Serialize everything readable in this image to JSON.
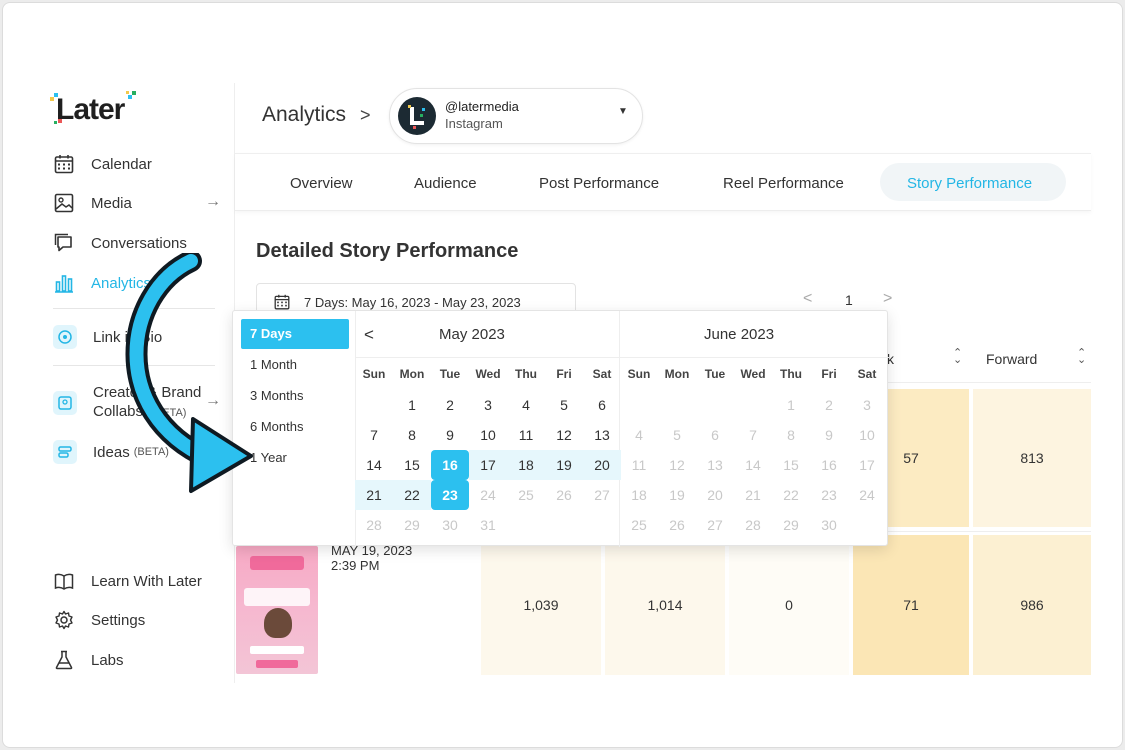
{
  "brand": {
    "name": "Later"
  },
  "sidebar": {
    "items": [
      {
        "label": "Calendar",
        "icon": "calendar-icon"
      },
      {
        "label": "Media",
        "icon": "image-icon"
      },
      {
        "label": "Conversations",
        "icon": "chat-icon"
      },
      {
        "label": "Analytics",
        "icon": "bar-chart-icon",
        "active": true
      },
      {
        "label": "Link in Bio",
        "icon": "link-in-bio-icon"
      },
      {
        "label": "Creator & Brand",
        "label2": "Collabs",
        "beta": "(BETA)",
        "icon": "collabs-icon"
      },
      {
        "label": "Ideas",
        "beta": "(BETA)",
        "icon": "ideas-icon"
      }
    ],
    "bottom": [
      {
        "label": "Learn With Later",
        "icon": "book-icon"
      },
      {
        "label": "Settings",
        "icon": "gear-icon"
      },
      {
        "label": "Labs",
        "icon": "flask-icon"
      }
    ],
    "arrow_glyph": "→"
  },
  "header": {
    "breadcrumb": "Analytics",
    "chevron": ">",
    "account": {
      "handle": "@latermedia",
      "platform": "Instagram",
      "caret": "▼"
    }
  },
  "tabs": [
    {
      "label": "Overview"
    },
    {
      "label": "Audience"
    },
    {
      "label": "Post Performance"
    },
    {
      "label": "Reel Performance"
    },
    {
      "label": "Story Performance",
      "active": true
    }
  ],
  "main": {
    "section_title": "Detailed Story Performance",
    "date_range": "7 Days: May 16, 2023 - May 23, 2023",
    "page": "1",
    "prev": "<",
    "next": ">"
  },
  "table": {
    "headers": {
      "partial": "k",
      "forward": "Forward"
    },
    "row1": {
      "k": "57",
      "forward": "813"
    },
    "row2": {
      "date": "MAY 19, 2023",
      "time": "2:39 PM",
      "c1": "1,039",
      "c2": "1,014",
      "c3": "0",
      "k": "71",
      "forward": "986"
    }
  },
  "popup": {
    "presets": [
      "7 Days",
      "1 Month",
      "3 Months",
      "6 Months",
      "1 Year"
    ],
    "active_preset": "7 Days",
    "prev": "<",
    "may": {
      "title": "May  2023",
      "dow": [
        "Sun",
        "Mon",
        "Tue",
        "Wed",
        "Thu",
        "Fri",
        "Sat"
      ],
      "weeks": [
        [
          "",
          "1",
          "2",
          "3",
          "4",
          "5",
          "6"
        ],
        [
          "7",
          "8",
          "9",
          "10",
          "11",
          "12",
          "13"
        ],
        [
          "14",
          "15",
          "16",
          "17",
          "18",
          "19",
          "20"
        ],
        [
          "21",
          "22",
          "23",
          "24",
          "25",
          "26",
          "27"
        ],
        [
          "28",
          "29",
          "30",
          "31",
          "",
          "",
          ""
        ]
      ]
    },
    "june": {
      "title": "June  2023",
      "dow": [
        "Sun",
        "Mon",
        "Tue",
        "Wed",
        "Thu",
        "Fri",
        "Sat"
      ],
      "weeks": [
        [
          "",
          "",
          "",
          "",
          "1",
          "2",
          "3"
        ],
        [
          "4",
          "5",
          "6",
          "7",
          "8",
          "9",
          "10"
        ],
        [
          "11",
          "12",
          "13",
          "14",
          "15",
          "16",
          "17"
        ],
        [
          "18",
          "19",
          "20",
          "21",
          "22",
          "23",
          "24"
        ],
        [
          "25",
          "26",
          "27",
          "28",
          "29",
          "30",
          ""
        ]
      ]
    },
    "range_start": "16",
    "range_end": "23"
  },
  "colors": {
    "accent": "#2cc0ef",
    "active_text": "#23b6e5",
    "range_bg": "#e6f7fc",
    "heat_light": "#fdf6e3",
    "heat_mid": "#fceac0",
    "arrow_fill": "#2cc0ef"
  }
}
